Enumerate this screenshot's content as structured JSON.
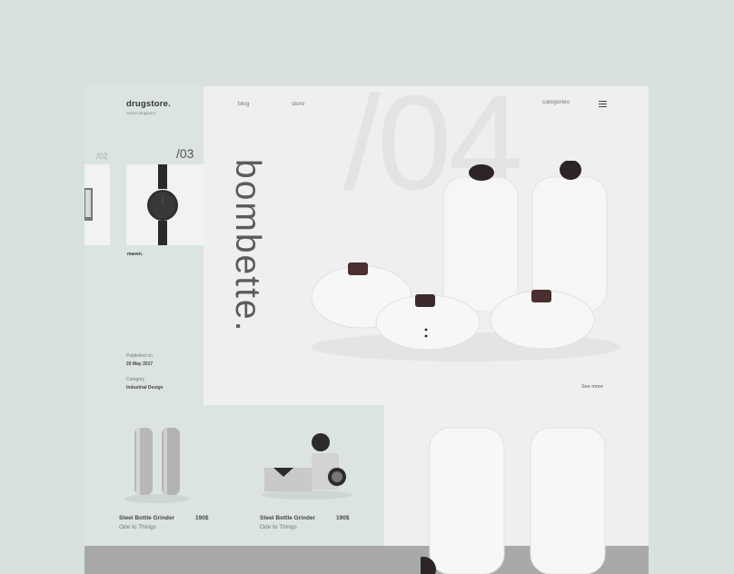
{
  "brand": {
    "name": "drugstore.",
    "tagline": "online drugstore"
  },
  "nav": {
    "blog": "blog",
    "store": "store",
    "categories": "categories"
  },
  "slides": {
    "big_number": "/04",
    "prev": "/02",
    "current": "/03",
    "current_label": "maven."
  },
  "hero": {
    "title": "bombette.",
    "see_more": "See more"
  },
  "meta": {
    "published_label": "Published on",
    "published_value": "20 May 2017",
    "category_label": "Category",
    "category_value": "Industrial Design"
  },
  "products": [
    {
      "name": "Steel Bottle Grinder",
      "brand": "Ode to Things",
      "price": "190$"
    },
    {
      "name": "Steel Bottle Grinder",
      "brand": "Ode to Things",
      "price": "190$"
    }
  ],
  "colors": {
    "background": "#d9e1dd",
    "panel": "#dbe4e0",
    "page": "#efefef",
    "text": "#333333"
  },
  "icons": [
    "menu-icon"
  ]
}
